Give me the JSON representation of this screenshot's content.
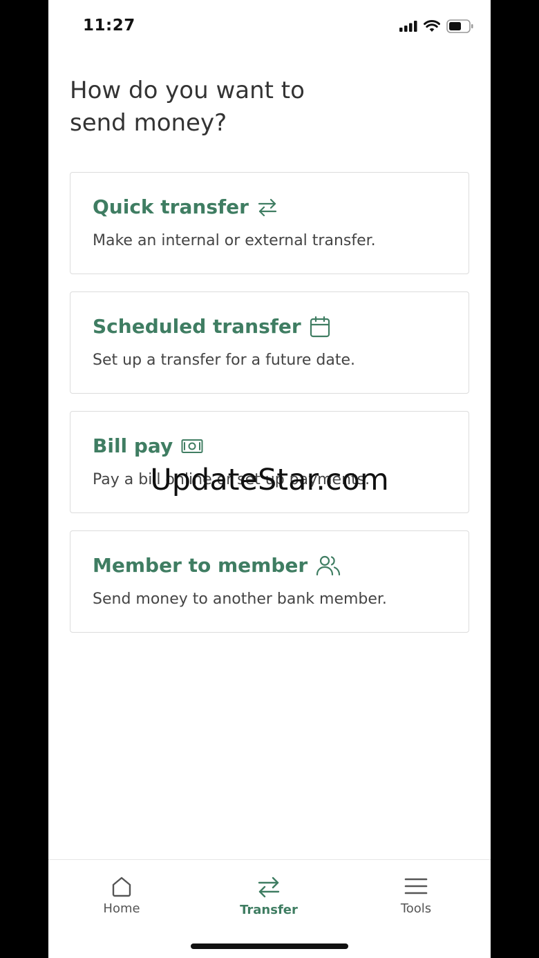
{
  "status_bar": {
    "time": "11:27"
  },
  "page": {
    "title": "How do you want to send money?"
  },
  "options": [
    {
      "title": "Quick transfer",
      "icon": "transfer-arrows-icon",
      "description": "Make an internal or external transfer."
    },
    {
      "title": "Scheduled transfer",
      "icon": "calendar-icon",
      "description": "Set up a transfer for a future date."
    },
    {
      "title": "Bill pay",
      "icon": "cash-icon",
      "description": "Pay a bill online or set up payments."
    },
    {
      "title": "Member to member",
      "icon": "users-icon",
      "description": "Send money to another bank member."
    }
  ],
  "watermark": "UpdateStar.com",
  "tab_bar": {
    "active_color": "#3f7d62",
    "tabs": [
      {
        "label": "Home",
        "icon": "home-icon",
        "active": false
      },
      {
        "label": "Transfer",
        "icon": "transfer-arrows-icon",
        "active": true
      },
      {
        "label": "Tools",
        "icon": "menu-icon",
        "active": false
      }
    ]
  },
  "colors": {
    "accent": "#3f7d62",
    "text": "#333333",
    "border": "#dcdcdc"
  }
}
